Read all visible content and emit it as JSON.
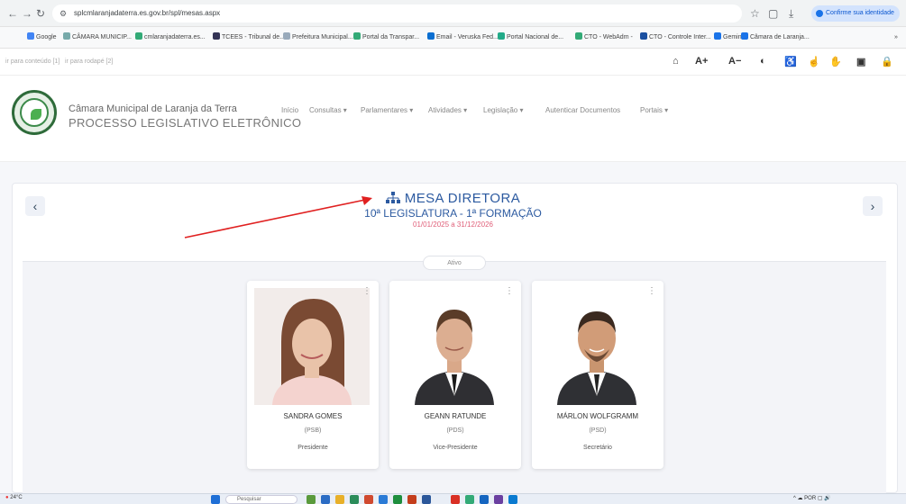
{
  "browser": {
    "url": "splcmlaranjadaterra.es.gov.br/spl/mesas.aspx",
    "confirm_label": "Confirme sua identidade",
    "bookmarks": [
      "Google",
      "CÂMARA MUNICIP...",
      "cmlaranjadaterra.es...",
      "TCEES - Tribunal de...",
      "Prefeitura Municipal...",
      "Portal da Transpar...",
      "Email - Veruska Fed...",
      "Portal Nacional de...",
      "CTO - WebAdm -",
      "CTO - Controle Inter...",
      "Gemini",
      "Câmara de Laranja..."
    ]
  },
  "accessibility": {
    "skip_content": "ir para conteúdo [1]",
    "skip_footer": "ir para rodapé [2]",
    "font_increase": "A+",
    "font_decrease": "A−"
  },
  "header": {
    "org_name": "Câmara Municipal de Laranja da Terra",
    "org_subtitle": "PROCESSO LEGISLATIVO ELETRÔNICO",
    "nav": [
      "Início",
      "Consultas ▾",
      "Parlamentares ▾",
      "Atividades ▾",
      "Legislação ▾",
      "Autenticar Documentos",
      "Portais ▾"
    ]
  },
  "mesa": {
    "title": "MESA DIRETORA",
    "legislature": "10ª LEGISLATURA - 1ª FORMAÇÃO",
    "period": "01/01/2025 a 31/12/2026",
    "status": "Ativo",
    "members": [
      {
        "name": "SANDRA GOMES",
        "party": "(PSB)",
        "role": "Presidente"
      },
      {
        "name": "GEANN RATUNDE",
        "party": "(PDS)",
        "role": "Vice-Presidente"
      },
      {
        "name": "MÁRLON WOLFGRAMM",
        "party": "(PSD)",
        "role": "Secretário"
      }
    ]
  },
  "taskbar": {
    "weather": "24°C",
    "search_placeholder": "Pesquisar",
    "tray": "POR"
  },
  "colors": {
    "title_blue": "#2c5aa0",
    "period_pink": "#e0607a",
    "arrow_red": "#e02020"
  }
}
